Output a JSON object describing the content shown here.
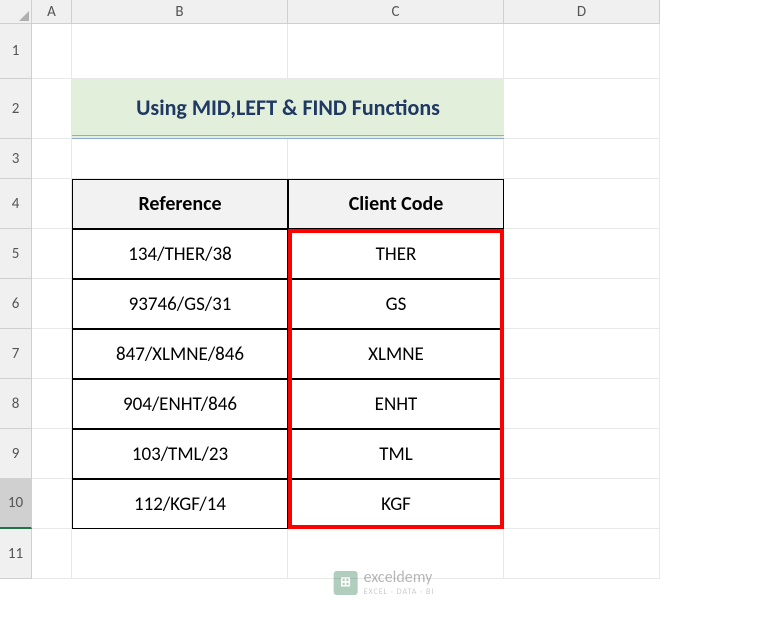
{
  "columns": [
    "",
    "A",
    "B",
    "C",
    "D"
  ],
  "rows": [
    "1",
    "2",
    "3",
    "4",
    "5",
    "6",
    "7",
    "8",
    "9",
    "10",
    "11"
  ],
  "title": "Using MID,LEFT & FIND Functions",
  "table": {
    "headers": [
      "Reference",
      "Client Code"
    ],
    "data": [
      {
        "ref": "134/THER/38",
        "code": "THER"
      },
      {
        "ref": "93746/GS/31",
        "code": "GS"
      },
      {
        "ref": "847/XLMNE/846",
        "code": "XLMNE"
      },
      {
        "ref": "904/ENHT/846",
        "code": "ENHT"
      },
      {
        "ref": "103/TML/23",
        "code": "TML"
      },
      {
        "ref": "112/KGF/14",
        "code": "KGF"
      }
    ]
  },
  "watermark": {
    "icon": "⊞",
    "title": "exceldemy",
    "subtitle": "EXCEL · DATA · BI"
  },
  "chart_data": {
    "type": "table",
    "title": "Using MID,LEFT & FIND Functions",
    "headers": [
      "Reference",
      "Client Code"
    ],
    "rows": [
      [
        "134/THER/38",
        "THER"
      ],
      [
        "93746/GS/31",
        "GS"
      ],
      [
        "847/XLMNE/846",
        "XLMNE"
      ],
      [
        "904/ENHT/846",
        "ENHT"
      ],
      [
        "103/TML/23",
        "TML"
      ],
      [
        "112/KGF/14",
        "KGF"
      ]
    ]
  }
}
